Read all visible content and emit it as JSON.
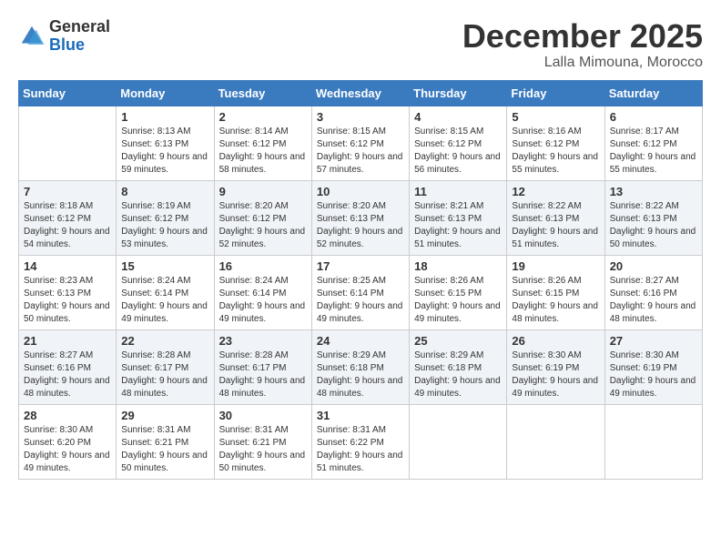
{
  "logo": {
    "general": "General",
    "blue": "Blue"
  },
  "title": {
    "month_year": "December 2025",
    "location": "Lalla Mimouna, Morocco"
  },
  "weekdays": [
    "Sunday",
    "Monday",
    "Tuesday",
    "Wednesday",
    "Thursday",
    "Friday",
    "Saturday"
  ],
  "weeks": [
    [
      {
        "day": "",
        "sunrise": "",
        "sunset": "",
        "daylight": ""
      },
      {
        "day": "1",
        "sunrise": "Sunrise: 8:13 AM",
        "sunset": "Sunset: 6:13 PM",
        "daylight": "Daylight: 9 hours and 59 minutes."
      },
      {
        "day": "2",
        "sunrise": "Sunrise: 8:14 AM",
        "sunset": "Sunset: 6:12 PM",
        "daylight": "Daylight: 9 hours and 58 minutes."
      },
      {
        "day": "3",
        "sunrise": "Sunrise: 8:15 AM",
        "sunset": "Sunset: 6:12 PM",
        "daylight": "Daylight: 9 hours and 57 minutes."
      },
      {
        "day": "4",
        "sunrise": "Sunrise: 8:15 AM",
        "sunset": "Sunset: 6:12 PM",
        "daylight": "Daylight: 9 hours and 56 minutes."
      },
      {
        "day": "5",
        "sunrise": "Sunrise: 8:16 AM",
        "sunset": "Sunset: 6:12 PM",
        "daylight": "Daylight: 9 hours and 55 minutes."
      },
      {
        "day": "6",
        "sunrise": "Sunrise: 8:17 AM",
        "sunset": "Sunset: 6:12 PM",
        "daylight": "Daylight: 9 hours and 55 minutes."
      }
    ],
    [
      {
        "day": "7",
        "sunrise": "Sunrise: 8:18 AM",
        "sunset": "Sunset: 6:12 PM",
        "daylight": "Daylight: 9 hours and 54 minutes."
      },
      {
        "day": "8",
        "sunrise": "Sunrise: 8:19 AM",
        "sunset": "Sunset: 6:12 PM",
        "daylight": "Daylight: 9 hours and 53 minutes."
      },
      {
        "day": "9",
        "sunrise": "Sunrise: 8:20 AM",
        "sunset": "Sunset: 6:12 PM",
        "daylight": "Daylight: 9 hours and 52 minutes."
      },
      {
        "day": "10",
        "sunrise": "Sunrise: 8:20 AM",
        "sunset": "Sunset: 6:13 PM",
        "daylight": "Daylight: 9 hours and 52 minutes."
      },
      {
        "day": "11",
        "sunrise": "Sunrise: 8:21 AM",
        "sunset": "Sunset: 6:13 PM",
        "daylight": "Daylight: 9 hours and 51 minutes."
      },
      {
        "day": "12",
        "sunrise": "Sunrise: 8:22 AM",
        "sunset": "Sunset: 6:13 PM",
        "daylight": "Daylight: 9 hours and 51 minutes."
      },
      {
        "day": "13",
        "sunrise": "Sunrise: 8:22 AM",
        "sunset": "Sunset: 6:13 PM",
        "daylight": "Daylight: 9 hours and 50 minutes."
      }
    ],
    [
      {
        "day": "14",
        "sunrise": "Sunrise: 8:23 AM",
        "sunset": "Sunset: 6:13 PM",
        "daylight": "Daylight: 9 hours and 50 minutes."
      },
      {
        "day": "15",
        "sunrise": "Sunrise: 8:24 AM",
        "sunset": "Sunset: 6:14 PM",
        "daylight": "Daylight: 9 hours and 49 minutes."
      },
      {
        "day": "16",
        "sunrise": "Sunrise: 8:24 AM",
        "sunset": "Sunset: 6:14 PM",
        "daylight": "Daylight: 9 hours and 49 minutes."
      },
      {
        "day": "17",
        "sunrise": "Sunrise: 8:25 AM",
        "sunset": "Sunset: 6:14 PM",
        "daylight": "Daylight: 9 hours and 49 minutes."
      },
      {
        "day": "18",
        "sunrise": "Sunrise: 8:26 AM",
        "sunset": "Sunset: 6:15 PM",
        "daylight": "Daylight: 9 hours and 49 minutes."
      },
      {
        "day": "19",
        "sunrise": "Sunrise: 8:26 AM",
        "sunset": "Sunset: 6:15 PM",
        "daylight": "Daylight: 9 hours and 48 minutes."
      },
      {
        "day": "20",
        "sunrise": "Sunrise: 8:27 AM",
        "sunset": "Sunset: 6:16 PM",
        "daylight": "Daylight: 9 hours and 48 minutes."
      }
    ],
    [
      {
        "day": "21",
        "sunrise": "Sunrise: 8:27 AM",
        "sunset": "Sunset: 6:16 PM",
        "daylight": "Daylight: 9 hours and 48 minutes."
      },
      {
        "day": "22",
        "sunrise": "Sunrise: 8:28 AM",
        "sunset": "Sunset: 6:17 PM",
        "daylight": "Daylight: 9 hours and 48 minutes."
      },
      {
        "day": "23",
        "sunrise": "Sunrise: 8:28 AM",
        "sunset": "Sunset: 6:17 PM",
        "daylight": "Daylight: 9 hours and 48 minutes."
      },
      {
        "day": "24",
        "sunrise": "Sunrise: 8:29 AM",
        "sunset": "Sunset: 6:18 PM",
        "daylight": "Daylight: 9 hours and 48 minutes."
      },
      {
        "day": "25",
        "sunrise": "Sunrise: 8:29 AM",
        "sunset": "Sunset: 6:18 PM",
        "daylight": "Daylight: 9 hours and 49 minutes."
      },
      {
        "day": "26",
        "sunrise": "Sunrise: 8:30 AM",
        "sunset": "Sunset: 6:19 PM",
        "daylight": "Daylight: 9 hours and 49 minutes."
      },
      {
        "day": "27",
        "sunrise": "Sunrise: 8:30 AM",
        "sunset": "Sunset: 6:19 PM",
        "daylight": "Daylight: 9 hours and 49 minutes."
      }
    ],
    [
      {
        "day": "28",
        "sunrise": "Sunrise: 8:30 AM",
        "sunset": "Sunset: 6:20 PM",
        "daylight": "Daylight: 9 hours and 49 minutes."
      },
      {
        "day": "29",
        "sunrise": "Sunrise: 8:31 AM",
        "sunset": "Sunset: 6:21 PM",
        "daylight": "Daylight: 9 hours and 50 minutes."
      },
      {
        "day": "30",
        "sunrise": "Sunrise: 8:31 AM",
        "sunset": "Sunset: 6:21 PM",
        "daylight": "Daylight: 9 hours and 50 minutes."
      },
      {
        "day": "31",
        "sunrise": "Sunrise: 8:31 AM",
        "sunset": "Sunset: 6:22 PM",
        "daylight": "Daylight: 9 hours and 51 minutes."
      },
      {
        "day": "",
        "sunrise": "",
        "sunset": "",
        "daylight": ""
      },
      {
        "day": "",
        "sunrise": "",
        "sunset": "",
        "daylight": ""
      },
      {
        "day": "",
        "sunrise": "",
        "sunset": "",
        "daylight": ""
      }
    ]
  ]
}
